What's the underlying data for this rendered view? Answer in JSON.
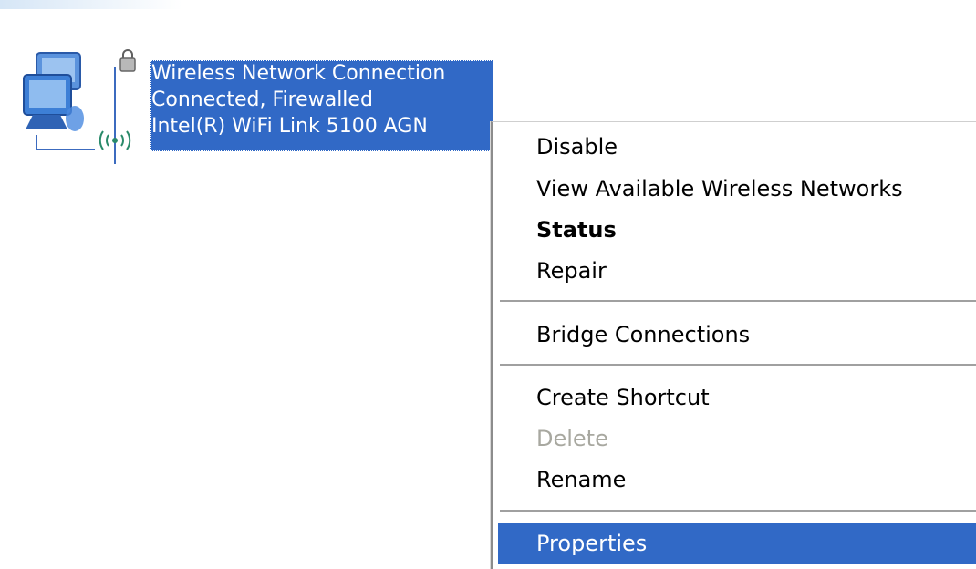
{
  "connection": {
    "name": "Wireless Network Connection",
    "status": "Connected, Firewalled",
    "adapter": "Intel(R) WiFi Link 5100 AGN",
    "icon": "wireless-network-connection-icon"
  },
  "menu": {
    "items": [
      {
        "label": "Disable"
      },
      {
        "label": "View Available Wireless Networks"
      },
      {
        "label": "Status",
        "default": true
      },
      {
        "label": "Repair"
      },
      {
        "label": "Bridge Connections"
      },
      {
        "label": "Create Shortcut"
      },
      {
        "label": "Delete",
        "disabled": true
      },
      {
        "label": "Rename"
      },
      {
        "label": "Properties",
        "highlighted": true
      }
    ]
  },
  "colors": {
    "selection": "#3169c6",
    "disabled_text": "#a8a8a0",
    "separator": "#a0a0a0"
  }
}
